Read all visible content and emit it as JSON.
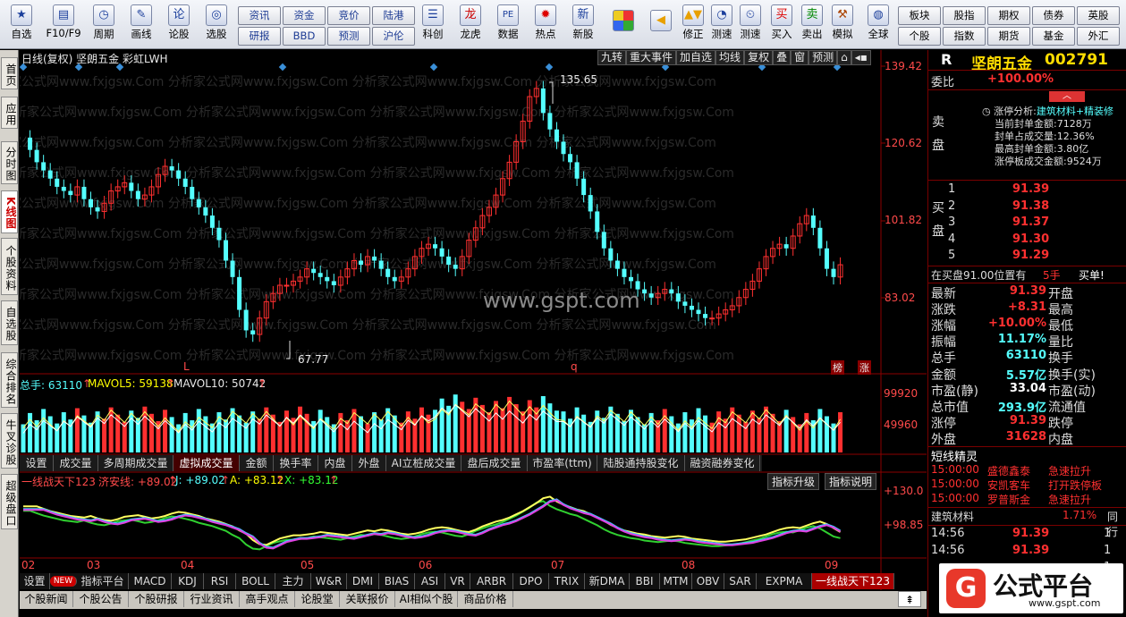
{
  "toolbar": {
    "items": [
      {
        "label": "自选",
        "icon": "star-icon"
      },
      {
        "label": "F10/F9",
        "icon": "f10-icon"
      },
      {
        "label": "周期",
        "icon": "clock-icon"
      },
      {
        "label": "画线",
        "icon": "pen-icon"
      },
      {
        "label": "论股",
        "icon": "lungu-icon"
      },
      {
        "label": "选股",
        "icon": "select-icon"
      },
      {
        "label": "科创",
        "icon": "kechuang-icon"
      },
      {
        "label": "龙虎",
        "icon": "longhu-icon"
      },
      {
        "label": "数据",
        "icon": "pe-icon"
      },
      {
        "label": "热点",
        "icon": "hot-icon"
      },
      {
        "label": "新股",
        "icon": "newstock-icon"
      },
      {
        "label": "修正",
        "icon": "updown-icon"
      },
      {
        "label": "测速",
        "icon": "speed-icon"
      },
      {
        "label": "买入",
        "icon": "buy-icon"
      },
      {
        "label": "卖出",
        "icon": "sell-icon"
      },
      {
        "label": "模拟",
        "icon": "hammer-icon"
      },
      {
        "label": "全球",
        "icon": "globe-icon"
      }
    ],
    "buttons_left": [
      [
        "资讯",
        "研报"
      ],
      [
        "资金",
        "BBD"
      ],
      [
        "竞价",
        "预测"
      ],
      [
        "陆港",
        "沪伦"
      ]
    ],
    "buttons_right": [
      [
        "板块",
        "个股"
      ],
      [
        "股指",
        "指数"
      ],
      [
        "期权",
        "期货"
      ],
      [
        "债券",
        "基金"
      ],
      [
        "英股",
        "外汇"
      ]
    ]
  },
  "sidetabs": [
    "首页",
    "应用",
    "分时图",
    "K线图",
    "个股资料",
    "自选股",
    "综合排名",
    "牛叉诊股",
    "超级盘口"
  ],
  "chart": {
    "header": "日线(复权)  坚朗五金 彩虹LWH",
    "top_buttons": [
      "九转",
      "重大事件",
      "加自选",
      "均线",
      "复权",
      "叠",
      "窗",
      "预测"
    ],
    "price_axis": [
      "139.42",
      "120.62",
      "101.82",
      "83.02"
    ],
    "high_label": "135.65",
    "low_label": "67.77",
    "watermark": "www.gspt.com",
    "bg_watermark": "分析家公式网www.fxjgsw.Com",
    "markers": [
      "L",
      "q",
      "榜",
      "涨"
    ],
    "volume_header": {
      "label": "总手: 63110",
      "mavol5": "MAVOL5: 59138",
      "mavol10": "MAVOL10: 50742"
    },
    "volume_axis": [
      "99920",
      "49960"
    ],
    "vol_tabs": [
      "设置",
      "成交量",
      "多周期成交量",
      "虚拟成交量",
      "金额",
      "换手率",
      "内盘",
      "外盘",
      "AI立桩成交量",
      "盘后成交量",
      "市盈率(ttm)",
      "陆股通持股变化",
      "融资融券变化"
    ],
    "indicator_header": {
      "name": "一线战天下123",
      "qax": "济安线: +89.02",
      "j": "J: +89.02",
      "a": "A: +83.12",
      "x": "X: +83.12"
    },
    "indicator_buttons": [
      "指标升级",
      "指标说明"
    ],
    "indicator_axis": [
      "+130.0",
      "+98.85"
    ],
    "months": [
      "02",
      "03",
      "04",
      "05",
      "06",
      "07",
      "08",
      "09"
    ],
    "ind_tabs": [
      "设置",
      "NEW",
      "指标平台",
      "MACD",
      "KDJ",
      "RSI",
      "BOLL",
      "主力",
      "W&R",
      "DMI",
      "BIAS",
      "ASI",
      "VR",
      "ARBR",
      "DPO",
      "TRIX",
      "新DMA",
      "BBI",
      "MTM",
      "OBV",
      "SAR",
      "EXPMA",
      "一线战天下123"
    ],
    "bottom_tabs": [
      "个股新闻",
      "个股公告",
      "个股研报",
      "行业资讯",
      "高手观点",
      "论股堂",
      "关联报价",
      "AI相似个股",
      "商品价格"
    ],
    "candles_desc": "daily candlestick bars"
  },
  "right_panel": {
    "code_prefix": "R",
    "name": "坚朗五金",
    "code": "002791",
    "weibi_label": "委比",
    "weibi": "+100.00%",
    "sell_label": "卖盘",
    "buy_label": "买盘",
    "limit_analysis": {
      "title": "涨停分析:",
      "value": "建筑材料+精装修",
      "lines": [
        "当前封单金额:7128万",
        "封单占成交量:12.36%",
        "最高封单金额:3.80亿",
        "涨停板成交金额:9524万"
      ]
    },
    "bids": [
      [
        "1",
        "91.39"
      ],
      [
        "2",
        "91.38"
      ],
      [
        "3",
        "91.37"
      ],
      [
        "4",
        "91.30"
      ],
      [
        "5",
        "91.29"
      ]
    ],
    "bid_note": "在买盘91.00位置有",
    "bid_note_vol": "5手",
    "bid_note_action": "买单!",
    "stats": [
      [
        "最新",
        "91.39",
        "开盘",
        ""
      ],
      [
        "涨跌",
        "+8.31",
        "最高",
        ""
      ],
      [
        "涨幅",
        "+10.00%",
        "最低",
        ""
      ],
      [
        "振幅",
        "11.17%",
        "量比",
        ""
      ],
      [
        "总手",
        "63110",
        "换手",
        ""
      ],
      [
        "金额",
        "5.57亿",
        "换手(实)",
        ""
      ],
      [
        "市盈(静)",
        "33.04",
        "市盈(动)",
        ""
      ],
      [
        "总市值",
        "293.9亿",
        "流通值",
        ""
      ],
      [
        "涨停",
        "91.39",
        "跌停",
        ""
      ],
      [
        "外盘",
        "31628",
        "内盘",
        ""
      ]
    ],
    "short_title": "短线精灵",
    "short_items": [
      [
        "15:00:00",
        "盛德鑫泰",
        "急速拉升"
      ],
      [
        "15:00:00",
        "安凯客车",
        "打开跌停板"
      ],
      [
        "15:00:00",
        "罗普斯金",
        "急速拉升"
      ]
    ],
    "sector": "建筑材料",
    "sector_pct": "1.71%",
    "sector_extra": "同行",
    "ticks": [
      [
        "14:56",
        "91.39",
        "1"
      ],
      [
        "14:56",
        "91.39",
        "1"
      ],
      [
        "",
        "",
        "1"
      ],
      [
        "",
        "",
        "1"
      ]
    ],
    "logo_text": "公式平台",
    "logo_url": "www.gspt.com"
  },
  "colors": {
    "up": "#ff3030",
    "down": "#54ffff",
    "axis_red": "#8b0000"
  }
}
